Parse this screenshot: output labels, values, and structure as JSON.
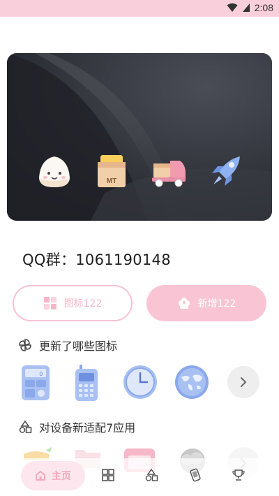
{
  "status_bar": {
    "time": "2:08",
    "background": "#f9cfdc"
  },
  "banner": {
    "icons": [
      "rice-ball-icon",
      "meituan-box-icon",
      "delivery-truck-icon",
      "rocket-icon"
    ]
  },
  "qq_group": {
    "text": "QQ群：1061190148"
  },
  "buttons": {
    "icons_label": "图标122",
    "new_label": "新增122",
    "accent": "#f9c5d5"
  },
  "section_updated": {
    "title": "更新了哪些图标",
    "icons": [
      "calculator-icon",
      "phone-icon",
      "clock-icon",
      "world-map-icon"
    ]
  },
  "section_adapted": {
    "title": "对设备新适配7应用",
    "icons": [
      "carrot-icon",
      "folder-icon",
      "calendar-icon",
      "cloud-icon"
    ]
  },
  "nav": {
    "home_label": "主页",
    "items": [
      "grid-icon",
      "shapes-icon",
      "phone-tilt-icon",
      "trophy-icon"
    ]
  }
}
